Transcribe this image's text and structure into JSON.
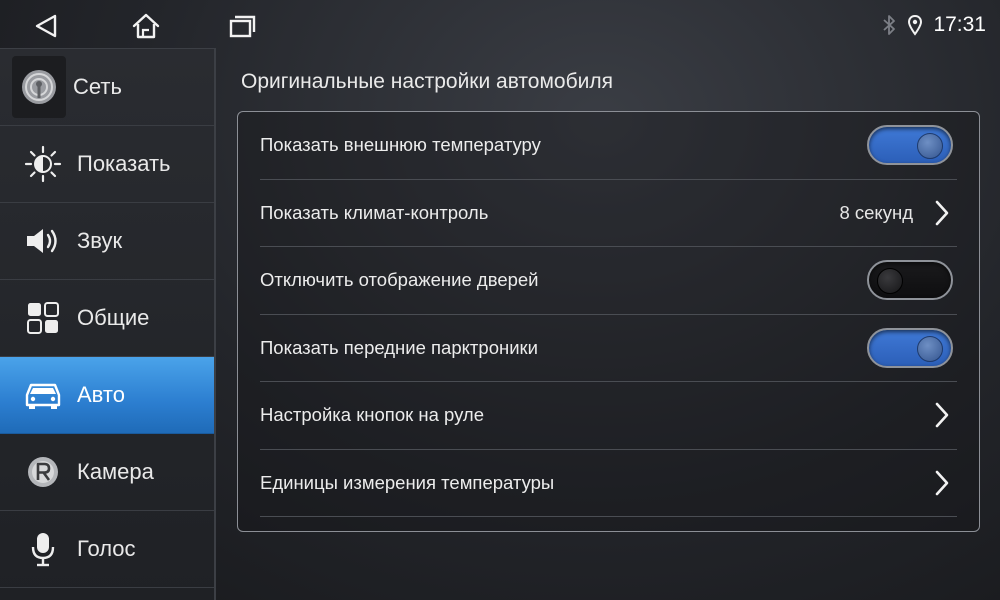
{
  "status": {
    "time": "17:31",
    "icons": [
      "bluetooth-icon",
      "location-pin-icon"
    ]
  },
  "nav": {
    "icons": [
      "back-icon",
      "home-icon",
      "recent-apps-icon"
    ]
  },
  "sidebar": {
    "items": [
      {
        "label": "Сеть",
        "icon": "network-icon",
        "active": false
      },
      {
        "label": "Показать",
        "icon": "brightness-icon",
        "active": false
      },
      {
        "label": "Звук",
        "icon": "speaker-icon",
        "active": false
      },
      {
        "label": "Общие",
        "icon": "grid-icon",
        "active": false
      },
      {
        "label": "Авто",
        "icon": "car-icon",
        "active": true
      },
      {
        "label": "Камера",
        "icon": "camera-r-icon",
        "active": false
      },
      {
        "label": "Голос",
        "icon": "microphone-icon",
        "active": false
      }
    ]
  },
  "main": {
    "title": "Оригинальные настройки автомобиля",
    "rows": [
      {
        "label": "Показать внешнюю температуру",
        "type": "toggle",
        "on": true
      },
      {
        "label": "Показать климат-контроль",
        "type": "value",
        "value": "8 секунд"
      },
      {
        "label": "Отключить отображение дверей",
        "type": "toggle",
        "on": false
      },
      {
        "label": "Показать передние парктроники",
        "type": "toggle",
        "on": true
      },
      {
        "label": "Настройка кнопок на руле",
        "type": "link"
      },
      {
        "label": "Единицы измерения температуры",
        "type": "link"
      }
    ]
  },
  "colors": {
    "accent": "#2c7ed0",
    "toggle_on": "#3f79d6"
  }
}
